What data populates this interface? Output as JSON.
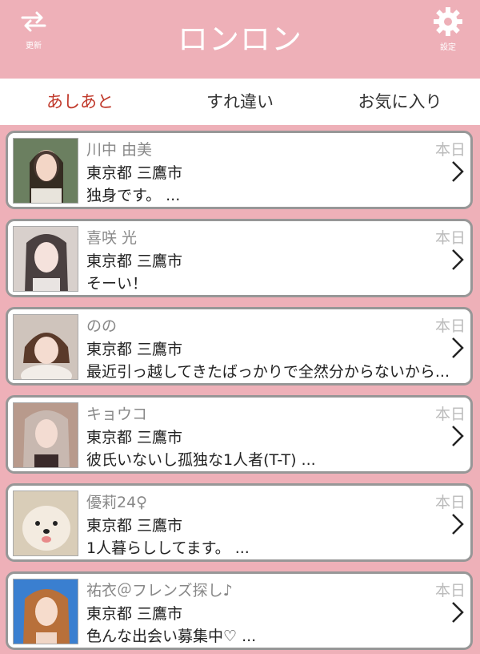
{
  "header": {
    "title": "ロンロン",
    "refresh_label": "更新",
    "settings_label": "設定"
  },
  "tabs": [
    {
      "label": "あしあと",
      "active": true
    },
    {
      "label": "すれ違い",
      "active": false
    },
    {
      "label": "お気に入り",
      "active": false
    }
  ],
  "users": [
    {
      "name": "川中 由美",
      "location": "東京都 三鷹市",
      "message": "独身です。 ...",
      "date": "本日"
    },
    {
      "name": "喜咲 光",
      "location": "東京都 三鷹市",
      "message": "そーい！",
      "date": "本日"
    },
    {
      "name": "のの",
      "location": "東京都 三鷹市",
      "message": "最近引っ越してきたばっかりで全然分からないから...",
      "date": "本日"
    },
    {
      "name": "キョウコ",
      "location": "東京都 三鷹市",
      "message": "彼氏いないし孤独な1人者(T-T) ...",
      "date": "本日"
    },
    {
      "name": "優莉24♀",
      "location": "東京都 三鷹市",
      "message": "1人暮らししてます。 ...",
      "date": "本日"
    },
    {
      "name": "祐衣＠フレンズ探し♪",
      "location": "東京都 三鷹市",
      "message": "色んな出会い募集中♡ ...",
      "date": "本日"
    }
  ],
  "colors": {
    "accent": "#eeb0b8",
    "active_tab": "#c0392b"
  }
}
